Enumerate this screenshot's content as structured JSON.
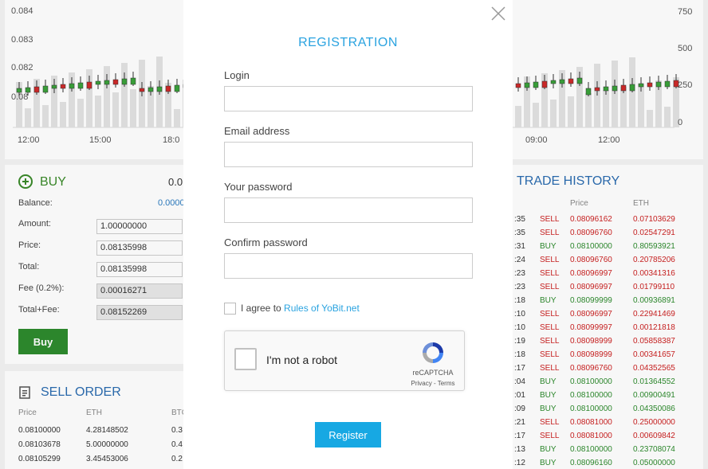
{
  "chart": {
    "y_left": [
      "0.084",
      "0.083",
      "0.082",
      "0.08"
    ],
    "y_right": [
      "750",
      "500",
      "250",
      "0"
    ],
    "x_left": [
      "12:00",
      "15:00",
      "18:0"
    ],
    "x_right": [
      "09:00",
      "12:00"
    ]
  },
  "buy": {
    "title": "BUY",
    "header_value": "0.0",
    "balance_label": "Balance:",
    "balance_value": "0.0000",
    "amount_label": "Amount:",
    "amount_value": "1.00000000",
    "price_label": "Price:",
    "price_value": "0.08135998",
    "total_label": "Total:",
    "total_value": "0.08135998",
    "fee_label": "Fee (0.2%):",
    "fee_value": "0.00016271",
    "totalfee_label": "Total+Fee:",
    "totalfee_value": "0.08152269",
    "button": "Buy"
  },
  "sell_order": {
    "title": "SELL ORDER",
    "headers": [
      "Price",
      "ETH",
      "BTC"
    ],
    "rows": [
      [
        "0.08100000",
        "4.28148502",
        "0.3"
      ],
      [
        "0.08103678",
        "5.00000000",
        "0.4"
      ],
      [
        "0.08105299",
        "3.45453006",
        "0.2"
      ]
    ]
  },
  "trade_history": {
    "title": "TRADE HISTORY",
    "headers": [
      "Price",
      "ETH"
    ],
    "rows": [
      {
        "time": ":35",
        "type": "SELL",
        "price": "0.08096162",
        "eth": "0.07103629"
      },
      {
        "time": ":35",
        "type": "SELL",
        "price": "0.08096760",
        "eth": "0.02547291"
      },
      {
        "time": ":31",
        "type": "BUY",
        "price": "0.08100000",
        "eth": "0.80593921"
      },
      {
        "time": ":24",
        "type": "SELL",
        "price": "0.08096760",
        "eth": "0.20785206"
      },
      {
        "time": ":23",
        "type": "SELL",
        "price": "0.08096997",
        "eth": "0.00341316"
      },
      {
        "time": ":23",
        "type": "SELL",
        "price": "0.08096997",
        "eth": "0.01799110"
      },
      {
        "time": ":18",
        "type": "BUY",
        "price": "0.08099999",
        "eth": "0.00936891"
      },
      {
        "time": ":10",
        "type": "SELL",
        "price": "0.08096997",
        "eth": "0.22941469"
      },
      {
        "time": ":10",
        "type": "SELL",
        "price": "0.08099997",
        "eth": "0.00121818"
      },
      {
        "time": ":19",
        "type": "SELL",
        "price": "0.08098999",
        "eth": "0.05858387"
      },
      {
        "time": ":18",
        "type": "SELL",
        "price": "0.08098999",
        "eth": "0.00341657"
      },
      {
        "time": ":17",
        "type": "SELL",
        "price": "0.08096760",
        "eth": "0.04352565"
      },
      {
        "time": ":04",
        "type": "BUY",
        "price": "0.08100000",
        "eth": "0.01364552"
      },
      {
        "time": ":01",
        "type": "BUY",
        "price": "0.08100000",
        "eth": "0.00900491"
      },
      {
        "time": ":09",
        "type": "BUY",
        "price": "0.08100000",
        "eth": "0.04350086"
      },
      {
        "time": ":21",
        "type": "SELL",
        "price": "0.08081000",
        "eth": "0.25000000"
      },
      {
        "time": ":17",
        "type": "SELL",
        "price": "0.08081000",
        "eth": "0.00609842"
      },
      {
        "time": ":13",
        "type": "BUY",
        "price": "0.08100000",
        "eth": "0.23708074"
      },
      {
        "time": ":12",
        "type": "BUY",
        "price": "0.08096160",
        "eth": "0.05000000"
      }
    ]
  },
  "modal": {
    "title": "REGISTRATION",
    "login_label": "Login",
    "email_label": "Email address",
    "password_label": "Your password",
    "confirm_label": "Confirm password",
    "agree_prefix": "I agree to ",
    "agree_link": "Rules of YoBit.net",
    "captcha_text": "I'm not a robot",
    "captcha_brand": "reCAPTCHA",
    "captcha_links": "Privacy - Terms",
    "register_button": "Register"
  },
  "colors": {
    "accent": "#2aa3e0",
    "buy_green": "#2e8b2e",
    "sell_red": "#cc2222",
    "register_bg": "#17a8e3"
  }
}
